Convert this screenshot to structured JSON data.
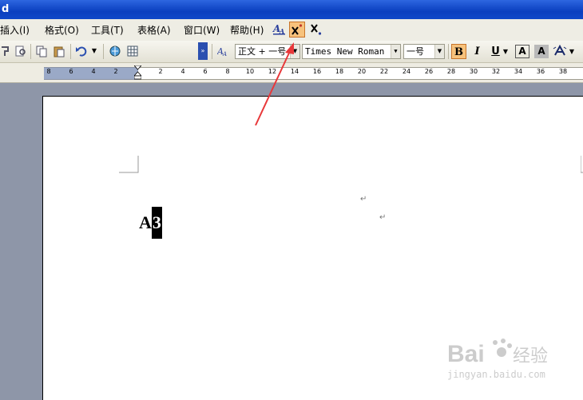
{
  "window": {
    "title": "d"
  },
  "menu": {
    "items": [
      {
        "label": "插入(I)",
        "name": "menu-insert"
      },
      {
        "label": "格式(O)",
        "name": "menu-format"
      },
      {
        "label": "工具(T)",
        "name": "menu-tools"
      },
      {
        "label": "表格(A)",
        "name": "menu-table"
      },
      {
        "label": "窗口(W)",
        "name": "menu-window"
      },
      {
        "label": "帮助(H)",
        "name": "menu-help"
      }
    ]
  },
  "toolbar": {
    "style": "正文 + 一号",
    "font": "Times New Roman",
    "size": "一号"
  },
  "ruler": {
    "left_ticks": [
      "8",
      "6",
      "4",
      "2"
    ],
    "right_ticks": [
      "2",
      "4",
      "6",
      "8",
      "10",
      "12",
      "14",
      "16",
      "18",
      "20",
      "22",
      "24",
      "26",
      "28",
      "30",
      "32",
      "34",
      "36",
      "38"
    ]
  },
  "document": {
    "text_normal": "A",
    "text_selected": "3",
    "para_mark": "↵"
  },
  "watermark": {
    "brand": "Bai",
    "brand2": "经验",
    "url": "jingyan.baidu.com"
  },
  "colors": {
    "title_bar": "#0a3fbf",
    "active_button": "#f7c27c",
    "annotation_arrow": "#e8383a"
  }
}
